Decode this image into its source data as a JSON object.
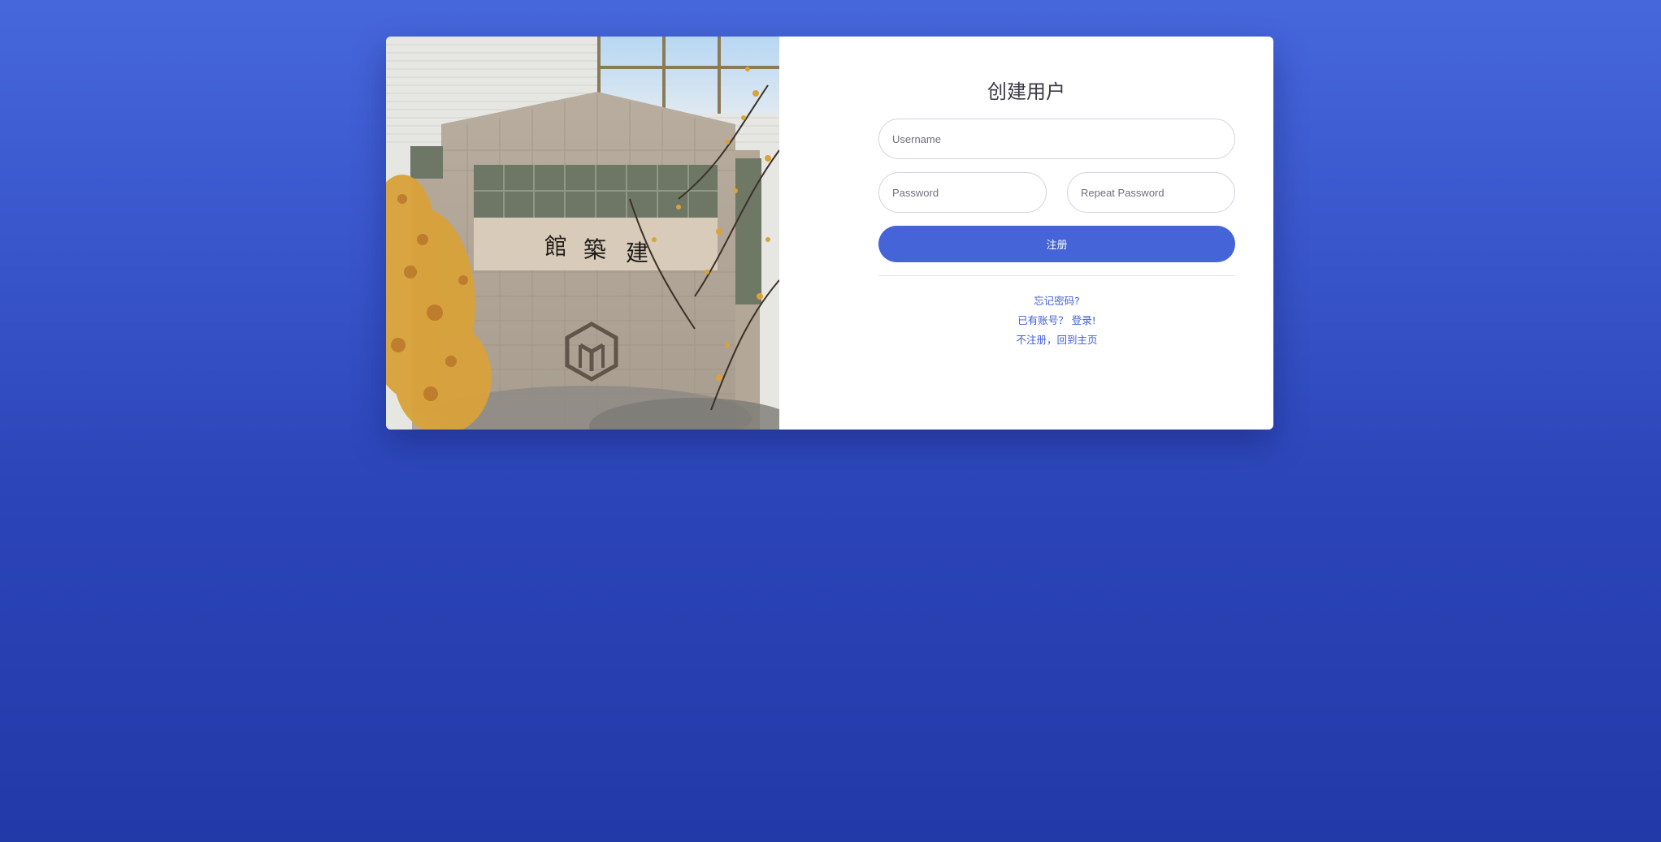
{
  "form": {
    "title": "创建用户",
    "username_placeholder": "Username",
    "password_placeholder": "Password",
    "repeat_password_placeholder": "Repeat Password",
    "register_label": "注册"
  },
  "links": {
    "forgot_password": "忘记密码?",
    "have_account_login": "已有账号？ 登录!",
    "skip_register_home": "不注册，回到主页"
  },
  "photo": {
    "inscription": [
      "館",
      "築",
      "建"
    ],
    "logo": "building-emblem-icon"
  },
  "colors": {
    "background_top": "#4667dc",
    "background_bottom": "#2239a8",
    "primary": "#4464d8",
    "link": "#3f5fd6"
  }
}
